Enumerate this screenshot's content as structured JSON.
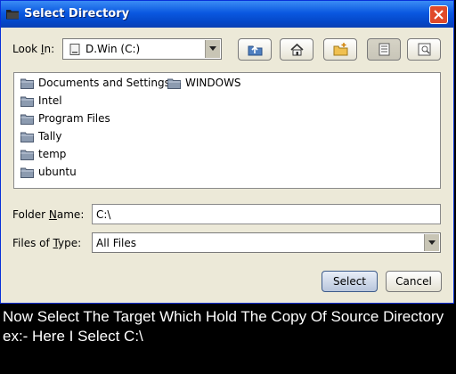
{
  "window": {
    "title": "Select Directory",
    "title_icon": "folder-icon",
    "close_icon": "close-icon"
  },
  "look_in": {
    "label_pre": "Look ",
    "label_ul": "I",
    "label_post": "n:",
    "value": "D.Win (C:)",
    "drive_icon": "drive-icon"
  },
  "toolbar": [
    {
      "name": "up-one-level-icon"
    },
    {
      "name": "home-icon"
    },
    {
      "name": "new-folder-icon"
    },
    {
      "name": "list-view-icon"
    },
    {
      "name": "details-view-icon"
    }
  ],
  "files": [
    {
      "label": "Documents and Settings"
    },
    {
      "label": "WINDOWS"
    },
    {
      "label": "Intel"
    },
    {
      "label": "Program Files"
    },
    {
      "label": "Tally"
    },
    {
      "label": "temp"
    },
    {
      "label": "ubuntu"
    }
  ],
  "folder_name": {
    "label_pre": "Folder ",
    "label_ul": "N",
    "label_post": "ame:",
    "value": "C:\\"
  },
  "files_of_type": {
    "label_pre": "Files of ",
    "label_ul": "T",
    "label_post": "ype:",
    "value": "All Files"
  },
  "buttons": {
    "select": "Select",
    "cancel": "Cancel"
  },
  "caption": "Now Select The Target Which Hold The Copy Of Source Directory   ex:- Here I Select C:\\"
}
